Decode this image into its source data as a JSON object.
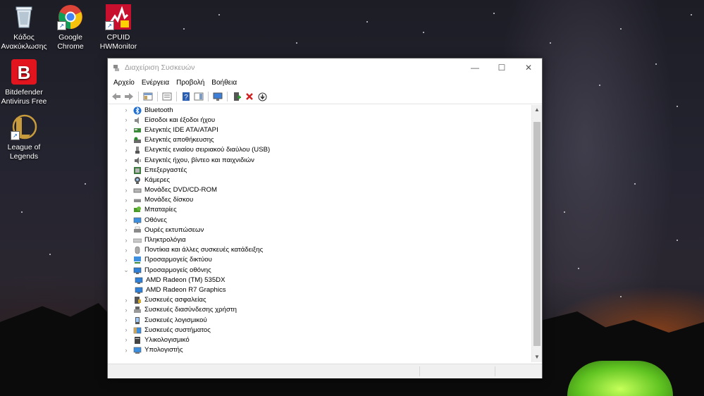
{
  "desktop": {
    "icons": [
      {
        "label": "Κάδος\nΑνακύκλωσης",
        "icon": "recycle-bin-icon"
      },
      {
        "label": "Google\nChrome",
        "icon": "chrome-icon"
      },
      {
        "label": "CPUID\nHWMonitor",
        "icon": "hwmonitor-icon"
      },
      {
        "label": "Bitdefender\nAntivirus Free",
        "icon": "bitdefender-icon"
      },
      {
        "label": "League of\nLegends",
        "icon": "league-icon"
      }
    ]
  },
  "window": {
    "title": "Διαχείριση Συσκευών",
    "controls": {
      "minimize": "—",
      "maximize": "☐",
      "close": "✕"
    },
    "menu": [
      "Αρχείο",
      "Ενέργεια",
      "Προβολή",
      "Βοήθεια"
    ],
    "toolbar": [
      "back-icon",
      "forward-icon",
      "show-hide-console-tree-icon",
      "properties-icon",
      "help-icon",
      "action-pane-icon",
      "scan-hardware-icon",
      "add-driver-icon",
      "uninstall-icon",
      "update-driver-icon"
    ],
    "tree": [
      {
        "label": "Bluetooth",
        "icon": "bluetooth-icon",
        "expanded": false
      },
      {
        "label": "Είσοδοι και έξοδοι ήχου",
        "icon": "speaker-icon",
        "expanded": false
      },
      {
        "label": "Ελεγκτές IDE ATA/ATAPI",
        "icon": "ide-controller-icon",
        "expanded": false
      },
      {
        "label": "Ελεγκτές αποθήκευσης",
        "icon": "storage-controller-icon",
        "expanded": false
      },
      {
        "label": "Ελεγκτές ενιαίου σειριακού διαύλου (USB)",
        "icon": "usb-icon",
        "expanded": false
      },
      {
        "label": "Ελεγκτές ήχου, βίντεο και παιχνιδιών",
        "icon": "sound-video-icon",
        "expanded": false
      },
      {
        "label": "Επεξεργαστές",
        "icon": "processor-icon",
        "expanded": false
      },
      {
        "label": "Κάμερες",
        "icon": "camera-icon",
        "expanded": false
      },
      {
        "label": "Μονάδες DVD/CD-ROM",
        "icon": "dvd-drive-icon",
        "expanded": false
      },
      {
        "label": "Μονάδες δίσκου",
        "icon": "disk-drive-icon",
        "expanded": false
      },
      {
        "label": "Μπαταρίες",
        "icon": "battery-icon",
        "expanded": false
      },
      {
        "label": "Οθόνες",
        "icon": "monitor-icon",
        "expanded": false
      },
      {
        "label": "Ουρές εκτυπώσεων",
        "icon": "printer-icon",
        "expanded": false
      },
      {
        "label": "Πληκτρολόγια",
        "icon": "keyboard-icon",
        "expanded": false
      },
      {
        "label": "Ποντίκια και άλλες συσκευές κατάδειξης",
        "icon": "mouse-icon",
        "expanded": false
      },
      {
        "label": "Προσαρμογείς δικτύου",
        "icon": "network-adapter-icon",
        "expanded": false
      },
      {
        "label": "Προσαρμογείς οθόνης",
        "icon": "display-adapter-icon",
        "expanded": true
      },
      {
        "label": "AMD Radeon (TM) 535DX",
        "icon": "display-adapter-icon",
        "child": true
      },
      {
        "label": "AMD Radeon R7 Graphics",
        "icon": "display-adapter-icon",
        "child": true
      },
      {
        "label": "Συσκευές ασφαλείας",
        "icon": "security-device-icon",
        "expanded": false
      },
      {
        "label": "Συσκευές διασύνδεσης χρήστη",
        "icon": "hid-icon",
        "expanded": false
      },
      {
        "label": "Συσκευές λογισμικού",
        "icon": "software-device-icon",
        "expanded": false
      },
      {
        "label": "Συσκευές συστήματος",
        "icon": "system-device-icon",
        "expanded": false
      },
      {
        "label": "Υλικολογισμικό",
        "icon": "firmware-icon",
        "expanded": false
      },
      {
        "label": "Υπολογιστής",
        "icon": "computer-icon",
        "expanded": false
      }
    ]
  }
}
